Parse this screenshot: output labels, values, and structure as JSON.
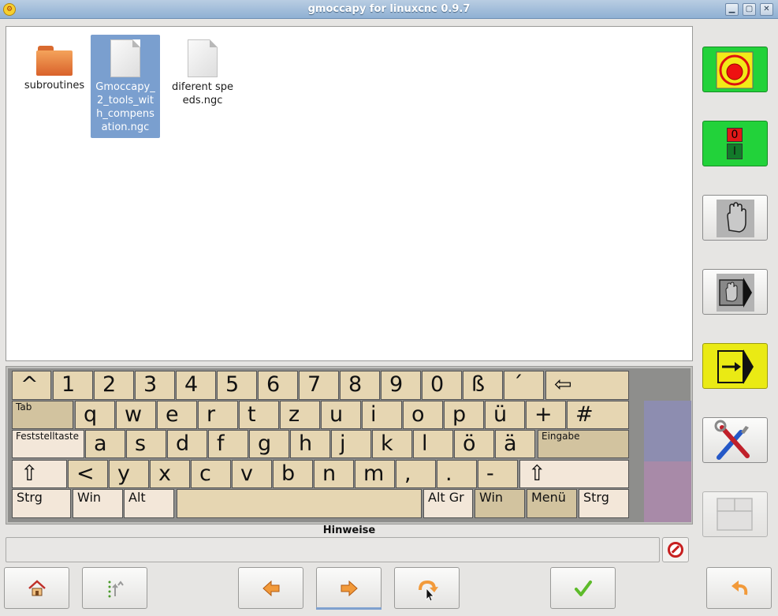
{
  "window": {
    "title": "gmoccapy for linuxcnc 0.9.7",
    "controls": [
      "minimize-icon",
      "maximize-icon",
      "close-icon"
    ]
  },
  "files": [
    {
      "name": "subroutines",
      "type": "folder",
      "selected": false
    },
    {
      "name": "Gmoccapy_2_tools_with_compensation.ngc",
      "type": "file",
      "selected": true
    },
    {
      "name": "diferent speeds.ngc",
      "type": "file",
      "selected": false
    }
  ],
  "keyboard": {
    "row1": [
      "^",
      "1",
      "2",
      "3",
      "4",
      "5",
      "6",
      "7",
      "8",
      "9",
      "0",
      "ß",
      "´",
      "⇦"
    ],
    "row2": [
      "Tab",
      "q",
      "w",
      "e",
      "r",
      "t",
      "z",
      "u",
      "i",
      "o",
      "p",
      "ü",
      "+",
      "#"
    ],
    "row3": [
      "Feststelltaste",
      "a",
      "s",
      "d",
      "f",
      "g",
      "h",
      "j",
      "k",
      "l",
      "ö",
      "ä",
      "Eingabe"
    ],
    "row4": [
      "⇧",
      "<",
      "y",
      "x",
      "c",
      "v",
      "b",
      "n",
      "m",
      ",",
      ".",
      "-",
      "⇧"
    ],
    "row5": [
      "Strg",
      "Win",
      "Alt",
      "",
      "Alt Gr",
      "Win",
      "Menü",
      "Strg"
    ]
  },
  "hints": {
    "label": "Hinweise",
    "value": ""
  },
  "right_panel": {
    "buttons": [
      {
        "name": "emergency-stop",
        "label": "Emergency-Stop",
        "color": "#22d23a"
      },
      {
        "name": "machine-power",
        "off_label": "0",
        "on_label": "I",
        "color": "#22d23a"
      },
      {
        "name": "manual-mode",
        "icon": "hand-icon"
      },
      {
        "name": "mdi-mode",
        "icon": "hand-arrow-icon"
      },
      {
        "name": "auto-mode",
        "icon": "arrow-right-icon",
        "color": "#eaea14"
      },
      {
        "name": "settings",
        "icon": "tools-icon"
      },
      {
        "name": "user-tabs",
        "icon": "tabs-icon",
        "disabled": true
      }
    ]
  },
  "bottom_bar": {
    "buttons": [
      {
        "name": "home",
        "icon": "home-icon"
      },
      {
        "name": "dir-up",
        "icon": "dir-up-icon"
      },
      {
        "name": "previous",
        "icon": "arrow-left-icon"
      },
      {
        "name": "next",
        "icon": "arrow-right-icon"
      },
      {
        "name": "jump-to",
        "icon": "jump-icon"
      },
      {
        "name": "select",
        "icon": "checkmark-icon"
      },
      {
        "name": "back",
        "icon": "undo-arrow-icon"
      }
    ]
  }
}
